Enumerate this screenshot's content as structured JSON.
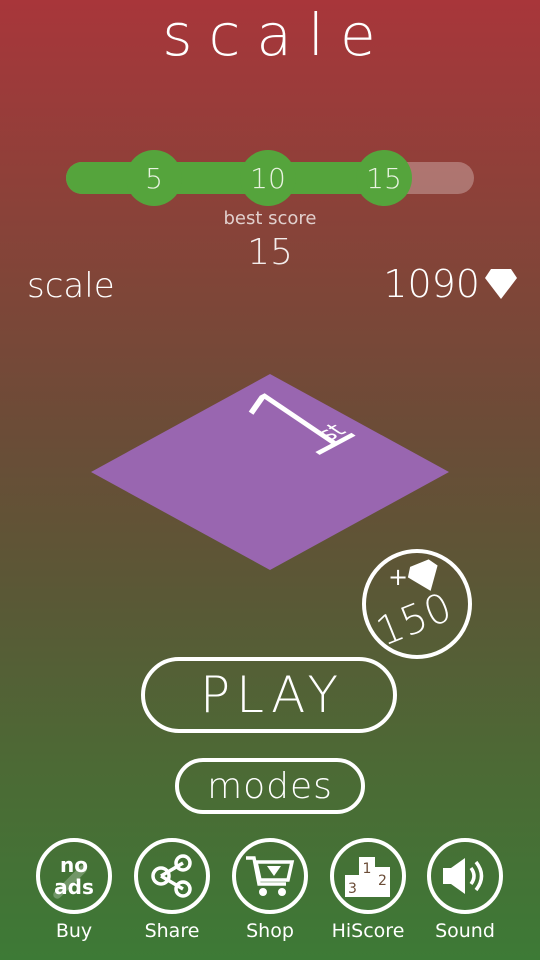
{
  "header": {
    "title": "scale"
  },
  "progress": {
    "milestones": [
      "5",
      "10",
      "15"
    ],
    "fraction": 0.81
  },
  "best": {
    "label": "best score",
    "value": "15"
  },
  "mode": {
    "name": "scale"
  },
  "currency": {
    "gems": "1090",
    "icon": "diamond-icon"
  },
  "board": {
    "rank": "1",
    "rank_suffix": "st",
    "color": "#9966b0"
  },
  "reward": {
    "plus": "+",
    "amount": "150",
    "icon": "diamond-icon"
  },
  "buttons": {
    "play": "PLAY",
    "modes": "modes"
  },
  "nav": {
    "items": [
      {
        "label": "Buy",
        "icon": "no-ads-icon",
        "badge_text_1": "no",
        "badge_text_2": "ads"
      },
      {
        "label": "Share",
        "icon": "share-icon"
      },
      {
        "label": "Shop",
        "icon": "cart-icon"
      },
      {
        "label": "HiScore",
        "icon": "podium-icon",
        "podium": [
          "1",
          "2",
          "3"
        ]
      },
      {
        "label": "Sound",
        "icon": "speaker-icon"
      }
    ]
  },
  "colors": {
    "top": "#a8363a",
    "bottom": "#3d7a36",
    "progress_fill": "#55a43c",
    "board": "#9966b0"
  }
}
